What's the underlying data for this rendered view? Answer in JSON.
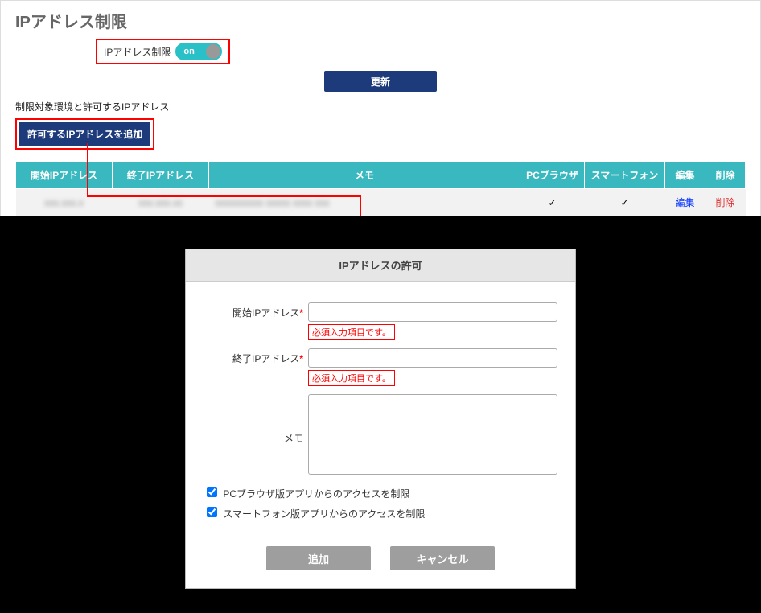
{
  "page": {
    "title": "IPアドレス制限",
    "toggle_label": "IPアドレス制限",
    "toggle_state": "on",
    "update_button": "更新",
    "section_label": "制限対象環境と許可するIPアドレス",
    "add_button": "許可するIPアドレスを追加"
  },
  "table": {
    "headers": {
      "start": "開始IPアドレス",
      "end": "終了IPアドレス",
      "memo": "メモ",
      "pc": "PCブラウザ",
      "sp": "スマートフォン",
      "edit": "編集",
      "del": "削除"
    },
    "row": {
      "start": "xxx.xxx.x",
      "end": "xxx.xxx.xx",
      "memo": "xxxxxxxxxx xxxxx xxxx  xxx",
      "pc_check": "✓",
      "sp_check": "✓",
      "edit": "編集",
      "del": "削除"
    }
  },
  "dialog": {
    "title": "IPアドレスの許可",
    "start_label": "開始IPアドレス",
    "end_label": "終了IPアドレス",
    "memo_label": "メモ",
    "required_mark": "*",
    "error_msg": "必須入力項目です。",
    "check_pc": "PCブラウザ版アプリからのアクセスを制限",
    "check_sp": "スマートフォン版アプリからのアクセスを制限",
    "add_btn": "追加",
    "cancel_btn": "キャンセル"
  }
}
